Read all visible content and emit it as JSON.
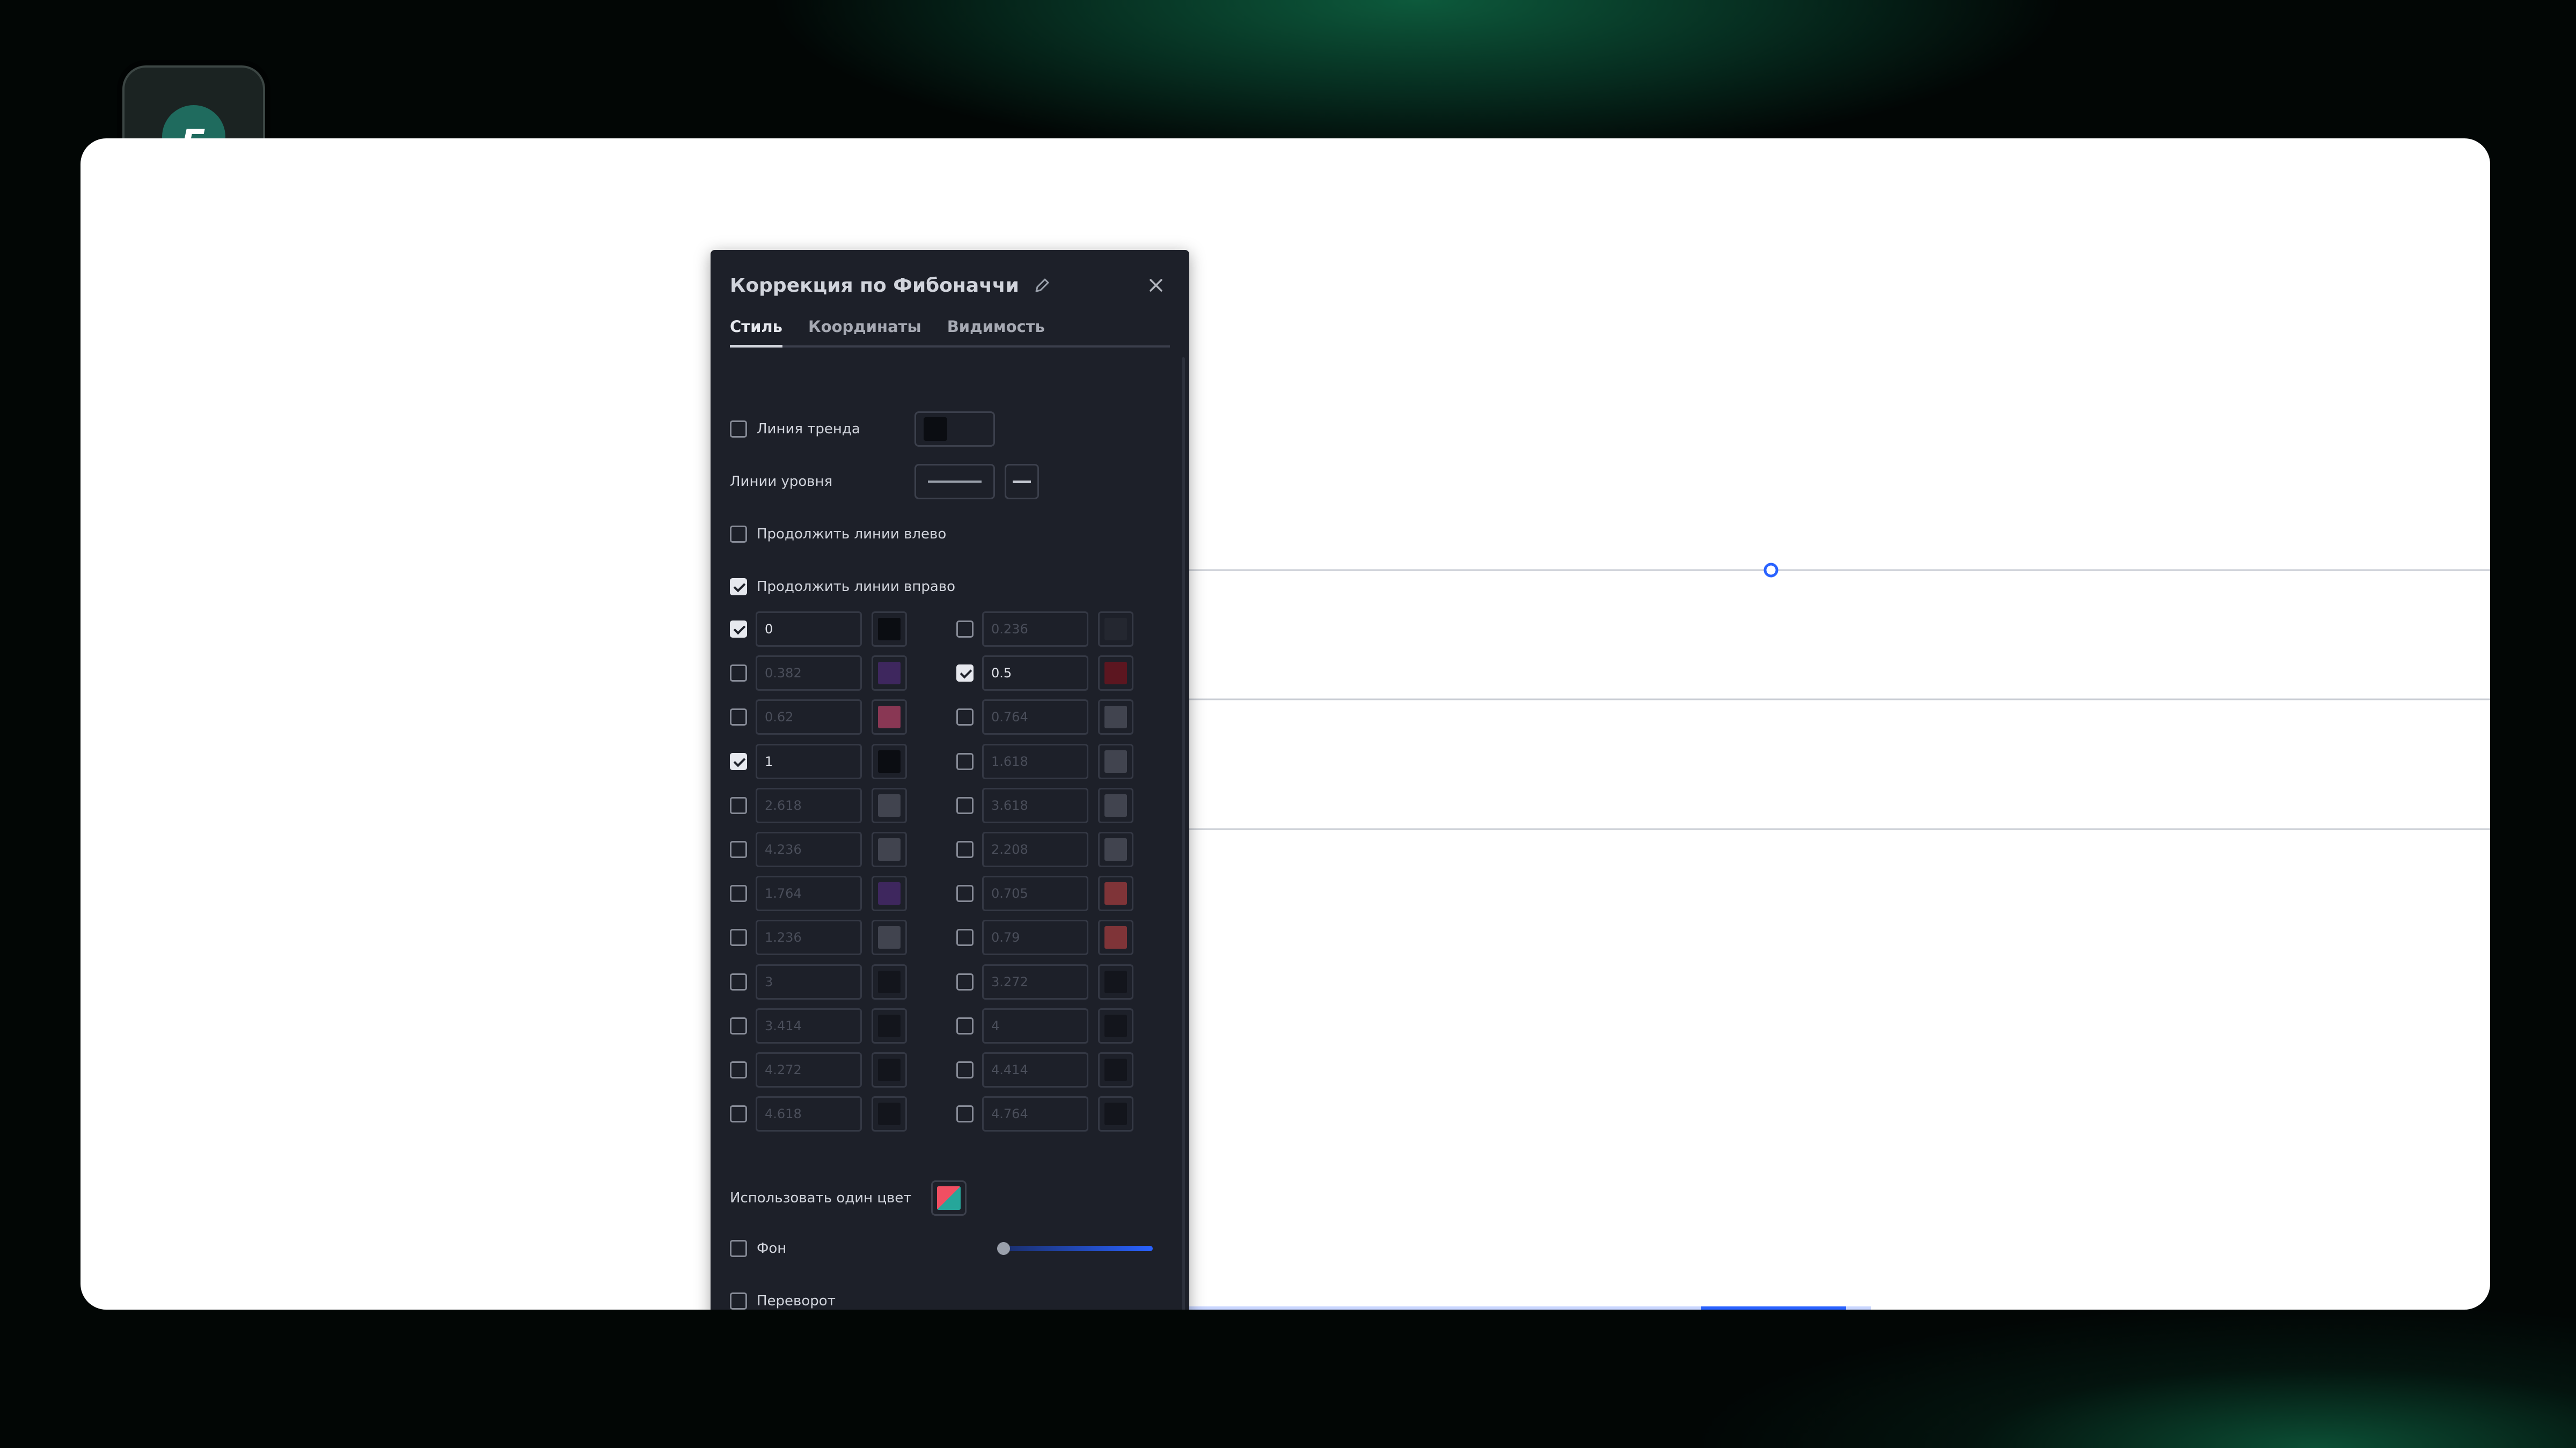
{
  "dialog": {
    "title": "Коррекция по Фибоначчи",
    "tabs": [
      {
        "label": "Стиль",
        "active": true
      },
      {
        "label": "Координаты",
        "active": false
      },
      {
        "label": "Видимость",
        "active": false
      }
    ],
    "trend_line": {
      "label": "Линия тренда",
      "checked": false,
      "color": "#0b0d12"
    },
    "level_lines": {
      "label": "Линии уровня"
    },
    "extend_left": {
      "label": "Продолжить линии влево",
      "checked": false
    },
    "extend_right": {
      "label": "Продолжить линии вправо",
      "checked": true
    },
    "levels": [
      {
        "value": "0",
        "checked": true,
        "color": "#0b0d12"
      },
      {
        "value": "0.236",
        "checked": false,
        "color": "#2a2d36"
      },
      {
        "value": "0.382",
        "checked": false,
        "color": "#5a2e8a"
      },
      {
        "value": "0.5",
        "checked": true,
        "color": "#5c1620"
      },
      {
        "value": "0.62",
        "checked": false,
        "color": "#e24a78"
      },
      {
        "value": "0.764",
        "checked": false,
        "color": "#5e6270"
      },
      {
        "value": "1",
        "checked": true,
        "color": "#0b0d12"
      },
      {
        "value": "1.618",
        "checked": false,
        "color": "#5e6270"
      },
      {
        "value": "2.618",
        "checked": false,
        "color": "#5e6270"
      },
      {
        "value": "3.618",
        "checked": false,
        "color": "#5e6270"
      },
      {
        "value": "4.236",
        "checked": false,
        "color": "#5e6270"
      },
      {
        "value": "2.208",
        "checked": false,
        "color": "#5e6270"
      },
      {
        "value": "1.764",
        "checked": false,
        "color": "#5a2e8a"
      },
      {
        "value": "0.705",
        "checked": false,
        "color": "#d04545"
      },
      {
        "value": "1.236",
        "checked": false,
        "color": "#5e6270"
      },
      {
        "value": "0.79",
        "checked": false,
        "color": "#d04545"
      },
      {
        "value": "3",
        "checked": false,
        "color": "#0b0d12"
      },
      {
        "value": "3.272",
        "checked": false,
        "color": "#0b0d12"
      },
      {
        "value": "3.414",
        "checked": false,
        "color": "#0b0d12"
      },
      {
        "value": "4",
        "checked": false,
        "color": "#0b0d12"
      },
      {
        "value": "4.272",
        "checked": false,
        "color": "#0b0d12"
      },
      {
        "value": "4.414",
        "checked": false,
        "color": "#0b0d12"
      },
      {
        "value": "4.618",
        "checked": false,
        "color": "#0b0d12"
      },
      {
        "value": "4.764",
        "checked": false,
        "color": "#0b0d12"
      }
    ],
    "use_one_color": {
      "label": "Использовать один цвет"
    },
    "background": {
      "label": "Фон",
      "checked": false,
      "opacity_level": 0.0
    },
    "reverse": {
      "label": "Переворот",
      "checked": false
    }
  },
  "icons": {
    "app_logo": "c-logo-icon",
    "edit": "pencil-icon",
    "close": "close-icon"
  },
  "colors": {
    "accent": "#2962ff",
    "dialog_bg": "#1d2029"
  }
}
